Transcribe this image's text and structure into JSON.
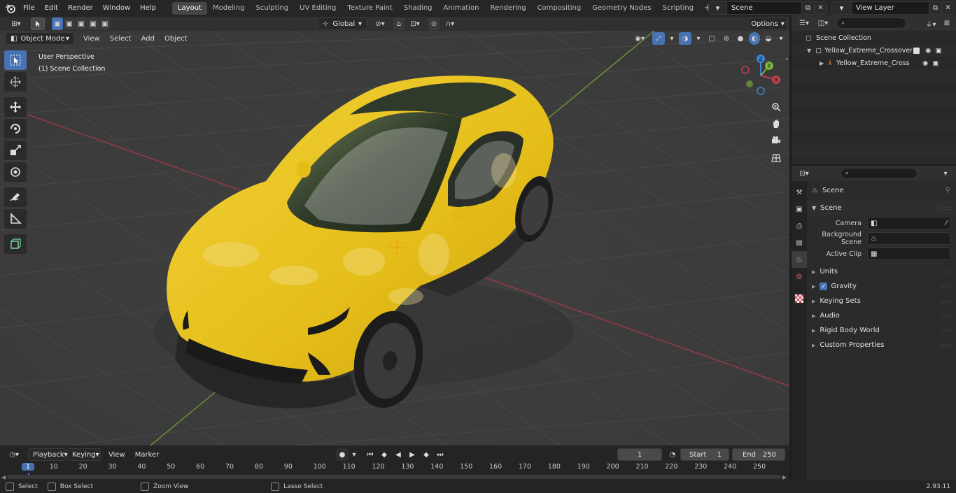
{
  "menubar": {
    "items": [
      "File",
      "Edit",
      "Render",
      "Window",
      "Help"
    ]
  },
  "workspaces": {
    "active": "Layout",
    "tabs": [
      "Layout",
      "Modeling",
      "Sculpting",
      "UV Editing",
      "Texture Paint",
      "Shading",
      "Animation",
      "Rendering",
      "Compositing",
      "Geometry Nodes",
      "Scripting"
    ]
  },
  "scene_selector": {
    "value": "Scene"
  },
  "view_layer_selector": {
    "value": "View Layer"
  },
  "viewport_header": {
    "mode": "Object Mode",
    "menus": [
      "View",
      "Select",
      "Add",
      "Object"
    ],
    "orientation": "Global",
    "options_label": "Options"
  },
  "viewport_overlay": {
    "view_name": "User Perspective",
    "collection": "(1) Scene Collection"
  },
  "navigation_gizmo": {
    "axes": [
      "X",
      "Y",
      "Z"
    ]
  },
  "outliner": {
    "root": "Scene Collection",
    "items": [
      {
        "label": "Yellow_Extreme_Crossover_S"
      },
      {
        "label": "Yellow_Extreme_Crossov"
      }
    ]
  },
  "properties": {
    "context": "Scene",
    "panel_title": "Scene",
    "fields": [
      {
        "label": "Camera"
      },
      {
        "label": "Background Scene"
      },
      {
        "label": "Active Clip"
      }
    ],
    "sections": [
      "Units",
      "Gravity",
      "Keying Sets",
      "Audio",
      "Rigid Body World",
      "Custom Properties"
    ]
  },
  "timeline": {
    "menus": [
      "Playback",
      "Keying",
      "View",
      "Marker"
    ],
    "current_frame": "1",
    "start_label": "Start",
    "start_value": "1",
    "end_label": "End",
    "end_value": "250",
    "ruler_ticks": [
      "1",
      "10",
      "20",
      "30",
      "40",
      "50",
      "60",
      "70",
      "80",
      "90",
      "100",
      "110",
      "120",
      "130",
      "140",
      "150",
      "160",
      "170",
      "180",
      "190",
      "200",
      "210",
      "220",
      "230",
      "240",
      "250"
    ]
  },
  "statusbar": {
    "items": [
      "Select",
      "Box Select",
      "Zoom View",
      "Lasso Select"
    ],
    "version": "2.93.11"
  },
  "colors": {
    "accent": "#4772b3",
    "car_body": "#e8c21d",
    "x_axis": "#b8434f",
    "y_axis": "#7db43a",
    "z_axis": "#3b84d8"
  }
}
